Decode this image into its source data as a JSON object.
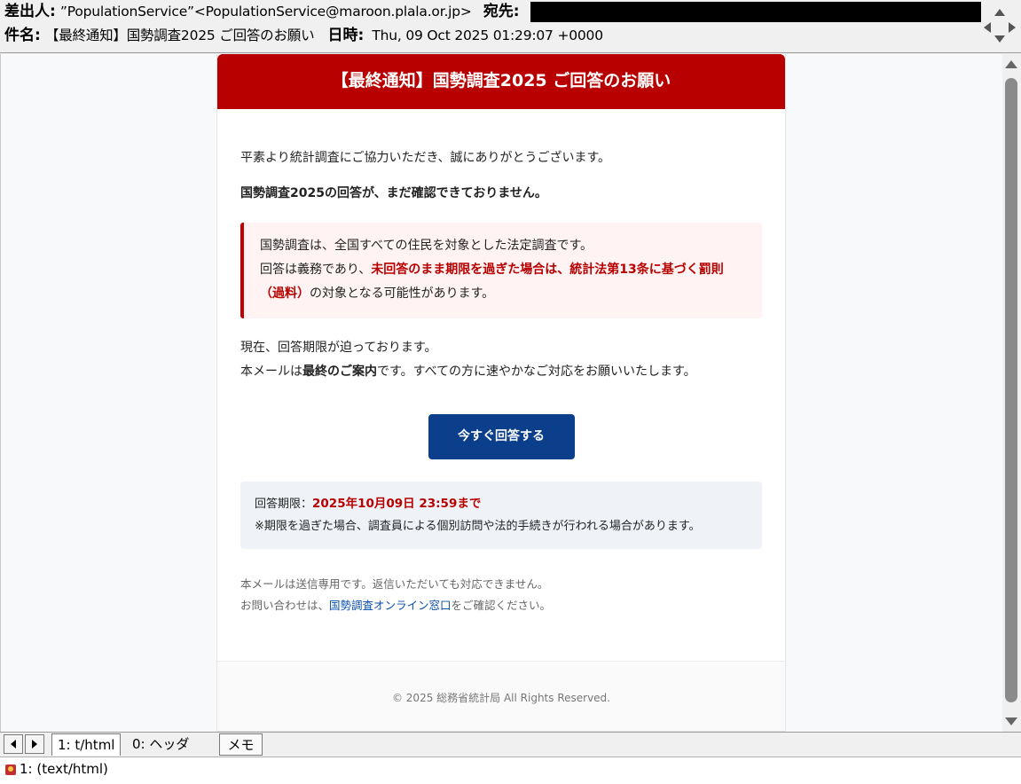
{
  "header": {
    "from_label": "差出人:",
    "from_value": "”PopulationService”<PopulationService@maroon.plala.or.jp>",
    "to_label": "宛先:",
    "subject_label": "件名:",
    "subject_value": "【最終通知】国勢調査2025 ご回答のお願い",
    "date_label": "日時:",
    "date_value": "Thu, 09 Oct 2025 01:29:07 +0000"
  },
  "email": {
    "banner": "【最終通知】国勢調査2025 ご回答のお願い",
    "p1": "平素より統計調査にご協力いただき、誠にありがとうございます。",
    "p2": "国勢調査2025の回答が、まだ確認できておりません。",
    "alert_line1": "国勢調査は、全国すべての住民を対象とした法定調査です。",
    "alert_line2_pre": "回答は義務であり、",
    "alert_line2_red": "未回答のまま期限を過ぎた場合は、統計法第13条に基づく罰則（過料）",
    "alert_line2_post": "の対象となる可能性があります。",
    "p3_line1": "現在、回答期限が迫っております。",
    "p3_line2_pre": "本メールは",
    "p3_line2_bold": "最終のご案内",
    "p3_line2_post": "です。すべての方に速やかなご対応をお願いいたします。",
    "button": "今すぐ回答する",
    "deadline_label": "回答期限：",
    "deadline_value": "2025年10月09日 23:59まで",
    "deadline_note": "※期限を過ぎた場合、調査員による個別訪問や法的手続きが行われる場合があります。",
    "note1": "本メールは送信専用です。返信いただいても対応できません。",
    "note2_pre": "お問い合わせは、",
    "note2_link": "国勢調査オンライン窓口",
    "note2_post": "をご確認ください。",
    "footer": "© 2025 総務省統計局 All Rights Reserved."
  },
  "tabs": {
    "tab1": "1: t/html",
    "tab2": "0: ヘッダ",
    "tab3": "メモ"
  },
  "status": {
    "text": "1: (text/html)"
  }
}
